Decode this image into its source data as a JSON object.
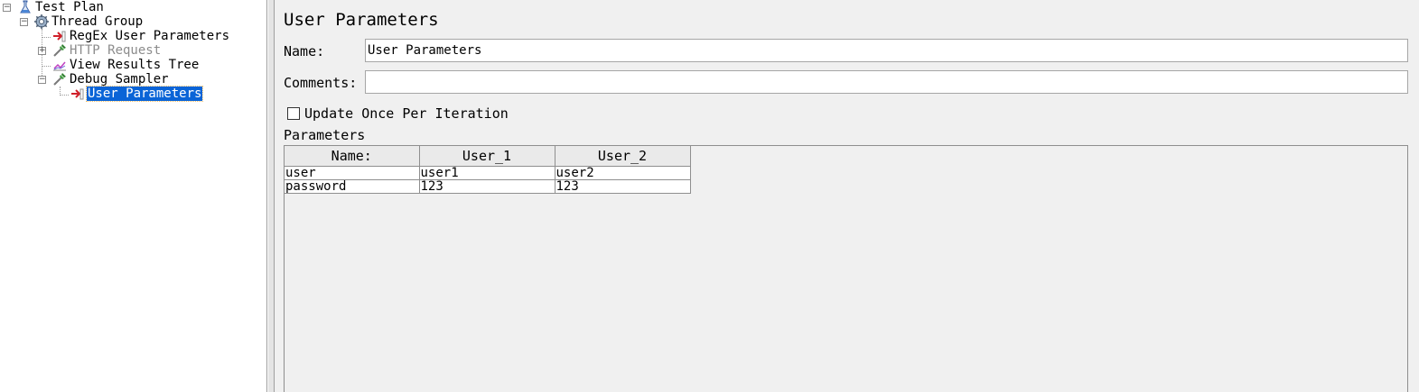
{
  "tree": {
    "items": [
      {
        "label": "Test Plan",
        "icon": "test-plan-icon",
        "expander": "minus"
      },
      {
        "label": "Thread Group",
        "icon": "thread-group-gear-icon",
        "expander": "minus"
      },
      {
        "label": "RegEx User Parameters",
        "icon": "preprocessor-icon",
        "expander": ""
      },
      {
        "label": "HTTP Request",
        "icon": "sampler-pipette-icon",
        "expander": "plus",
        "disabled": true
      },
      {
        "label": "View Results Tree",
        "icon": "listener-chart-icon",
        "expander": ""
      },
      {
        "label": "Debug Sampler",
        "icon": "sampler-pipette-icon",
        "expander": "minus"
      },
      {
        "label": "User Parameters",
        "icon": "preprocessor-icon",
        "expander": "",
        "selected": true
      }
    ]
  },
  "panel": {
    "title": "User Parameters",
    "name_label": "Name:",
    "name_value": "User Parameters",
    "comments_label": "Comments:",
    "comments_value": "",
    "update_once_label": "Update Once Per Iteration",
    "update_once_checked": false,
    "parameters_label": "Parameters"
  },
  "table": {
    "headers": [
      "Name:",
      "User_1",
      "User_2"
    ],
    "rows": [
      [
        "user",
        "user1",
        "user2"
      ],
      [
        "password",
        "123",
        "123"
      ]
    ]
  },
  "colors": {
    "selection": "#0a64d7",
    "tree_background": "#ffffff",
    "panel_background": "#f0f0f0"
  }
}
